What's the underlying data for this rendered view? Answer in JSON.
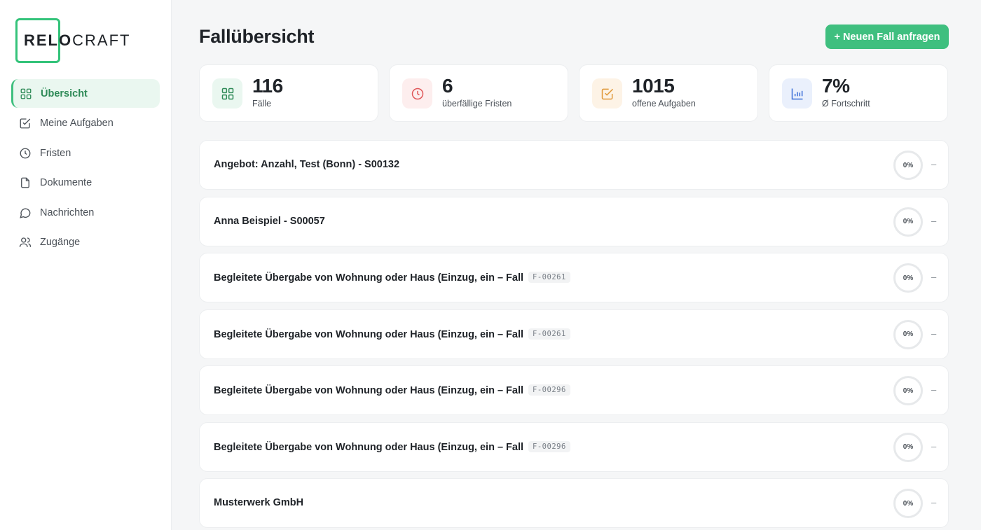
{
  "app": {
    "logo_bold": "RELO",
    "logo_light": "CRAFT"
  },
  "sidebar": {
    "items": [
      {
        "label": "Übersicht",
        "icon": "grid-icon",
        "active": true
      },
      {
        "label": "Meine Aufgaben",
        "icon": "checkbox-icon"
      },
      {
        "label": "Fristen",
        "icon": "clock-icon"
      },
      {
        "label": "Dokumente",
        "icon": "document-icon"
      },
      {
        "label": "Nachrichten",
        "icon": "message-icon"
      },
      {
        "label": "Zugänge",
        "icon": "users-icon"
      }
    ]
  },
  "header": {
    "title": "Fallübersicht",
    "new_case_button": "+ Neuen Fall anfragen"
  },
  "stats": [
    {
      "value": "116",
      "label": "Fälle",
      "icon": "grid-icon",
      "color": "#2e8a57",
      "bg": "#eaf7f0"
    },
    {
      "value": "6",
      "label": "überfällige Fristen",
      "icon": "clock-icon",
      "color": "#e0585a",
      "bg": "#fdeeee"
    },
    {
      "value": "1015",
      "label": "offene Aufgaben",
      "icon": "checkbox-icon",
      "color": "#e0993a",
      "bg": "#fdf3e6"
    },
    {
      "value": "7%",
      "label": "Ø Fortschritt",
      "icon": "bar-chart-icon",
      "color": "#3b6fd8",
      "bg": "#eaf0fc"
    }
  ],
  "cases": [
    {
      "title": "Angebot: Anzahl, Test (Bonn) - S00132",
      "code": "",
      "progress": "0%",
      "status": "–"
    },
    {
      "title": "Anna Beispiel - S00057",
      "code": "",
      "progress": "0%",
      "status": "–"
    },
    {
      "title": "Begleitete Übergabe von Wohnung oder Haus (Einzug, ein – Fall",
      "code": "F-00261",
      "progress": "0%",
      "status": "–"
    },
    {
      "title": "Begleitete Übergabe von Wohnung oder Haus (Einzug, ein – Fall",
      "code": "F-00261",
      "progress": "0%",
      "status": "–"
    },
    {
      "title": "Begleitete Übergabe von Wohnung oder Haus (Einzug, ein – Fall",
      "code": "F-00296",
      "progress": "0%",
      "status": "–"
    },
    {
      "title": "Begleitete Übergabe von Wohnung oder Haus (Einzug, ein – Fall",
      "code": "F-00296",
      "progress": "0%",
      "status": "–"
    },
    {
      "title": "Musterwerk GmbH",
      "code": "",
      "progress": "0%",
      "status": "–"
    }
  ]
}
